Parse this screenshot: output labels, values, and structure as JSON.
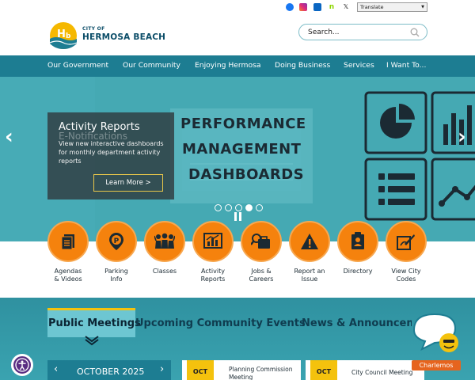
{
  "header": {
    "logo_line1": "CITY OF",
    "logo_line2": "HERMOSA BEACH",
    "social_icons": [
      "facebook-icon",
      "instagram-icon",
      "linkedin-icon",
      "nextdoor-icon",
      "x-icon"
    ],
    "translate_label": "Translate",
    "search_placeholder": "Search..."
  },
  "nav": {
    "items": [
      "Our Government",
      "Our Community",
      "Enjoying Hermosa",
      "Doing Business",
      "Services",
      "I Want To..."
    ]
  },
  "hero": {
    "panel_title": "Activity Reports",
    "panel_ghost_title": "E-Notifications",
    "panel_body": "View new interactive dashboards for monthly department activity reports",
    "button_label": "Learn More >",
    "headline_lines": [
      "PERFORMANCE",
      "MANAGEMENT",
      "DASHBOARDS"
    ],
    "slide_count": 5,
    "active_slide": 4
  },
  "quick_links": [
    {
      "label1": "Agendas",
      "label2": "& Videos",
      "icon": "agenda-icon"
    },
    {
      "label1": "Parking",
      "label2": "Info",
      "icon": "parking-icon"
    },
    {
      "label1": "Classes",
      "label2": "",
      "icon": "classes-icon"
    },
    {
      "label1": "Activity",
      "label2": "Reports",
      "icon": "activity-reports-icon"
    },
    {
      "label1": "Jobs &",
      "label2": "Careers",
      "icon": "jobs-icon"
    },
    {
      "label1": "Report an",
      "label2": "Issue",
      "icon": "report-issue-icon"
    },
    {
      "label1": "Directory",
      "label2": "",
      "icon": "directory-icon"
    },
    {
      "label1": "View City",
      "label2": "Codes",
      "icon": "city-codes-icon"
    }
  ],
  "tabs": [
    "Public Meetings",
    "Upcoming Community Events",
    "News & Announcements"
  ],
  "calendar": {
    "month": "OCTOBER 2025",
    "prev": "‹",
    "next": "›"
  },
  "meetings": [
    {
      "month": "OCT",
      "title_line1": "Planning Commission",
      "title_line2": "Meeting"
    },
    {
      "month": "OCT",
      "title_line1": "City Council Meeting",
      "title_line2": ""
    }
  ],
  "chat": {
    "label": "Charlemos"
  },
  "colors": {
    "teal_nav": "#1d7d92",
    "orange": "#f5820d",
    "yellow": "#f4c20d",
    "hero": "#4fb2bb"
  }
}
